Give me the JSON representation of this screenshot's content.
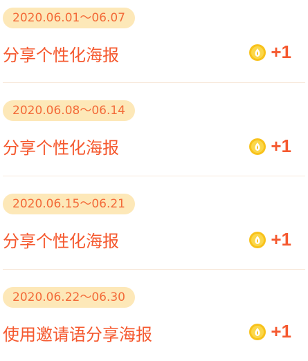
{
  "weeks": [
    {
      "date_range": "2020.06.01～06.07",
      "task": "分享个性化海报",
      "reward": "+1"
    },
    {
      "date_range": "2020.06.08～06.14",
      "task": "分享个性化海报",
      "reward": "+1"
    },
    {
      "date_range": "2020.06.15～06.21",
      "task": "分享个性化海报",
      "reward": "+1"
    },
    {
      "date_range": "2020.06.22～06.30",
      "task": "使用邀请语分享海报",
      "reward": "+1"
    }
  ],
  "colors": {
    "accent": "#f5592f",
    "pill_bg": "#fde8b8",
    "coin": "#f8c21b"
  },
  "icons": {
    "reward": "coin-icon"
  }
}
